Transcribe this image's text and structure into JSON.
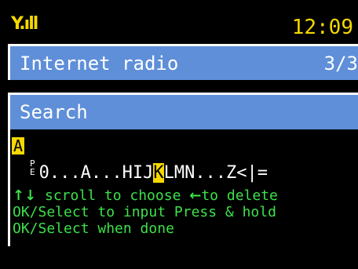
{
  "colors": {
    "accent_yellow": "#f5d800",
    "bar_blue": "#5f8fd8",
    "help_green": "#3de14a",
    "background": "#000000"
  },
  "status": {
    "signal_icon": "signal-strength-icon",
    "time": "12:09"
  },
  "header": {
    "title": "Internet radio",
    "page": "3/3"
  },
  "search": {
    "title": "Search",
    "entry": "A",
    "char_list_icon": "pe-icon",
    "chars_before": "0...A...HIJ",
    "chars_selected": "K",
    "chars_after": "LMN...Z<|="
  },
  "help": {
    "line1_up_down": "↑↓",
    "line1_text1": " scroll to choose ",
    "line1_left": "←",
    "line1_text2": "to delete",
    "line2": "OK/Select to input Press & hold",
    "line3": "OK/Select when done"
  }
}
